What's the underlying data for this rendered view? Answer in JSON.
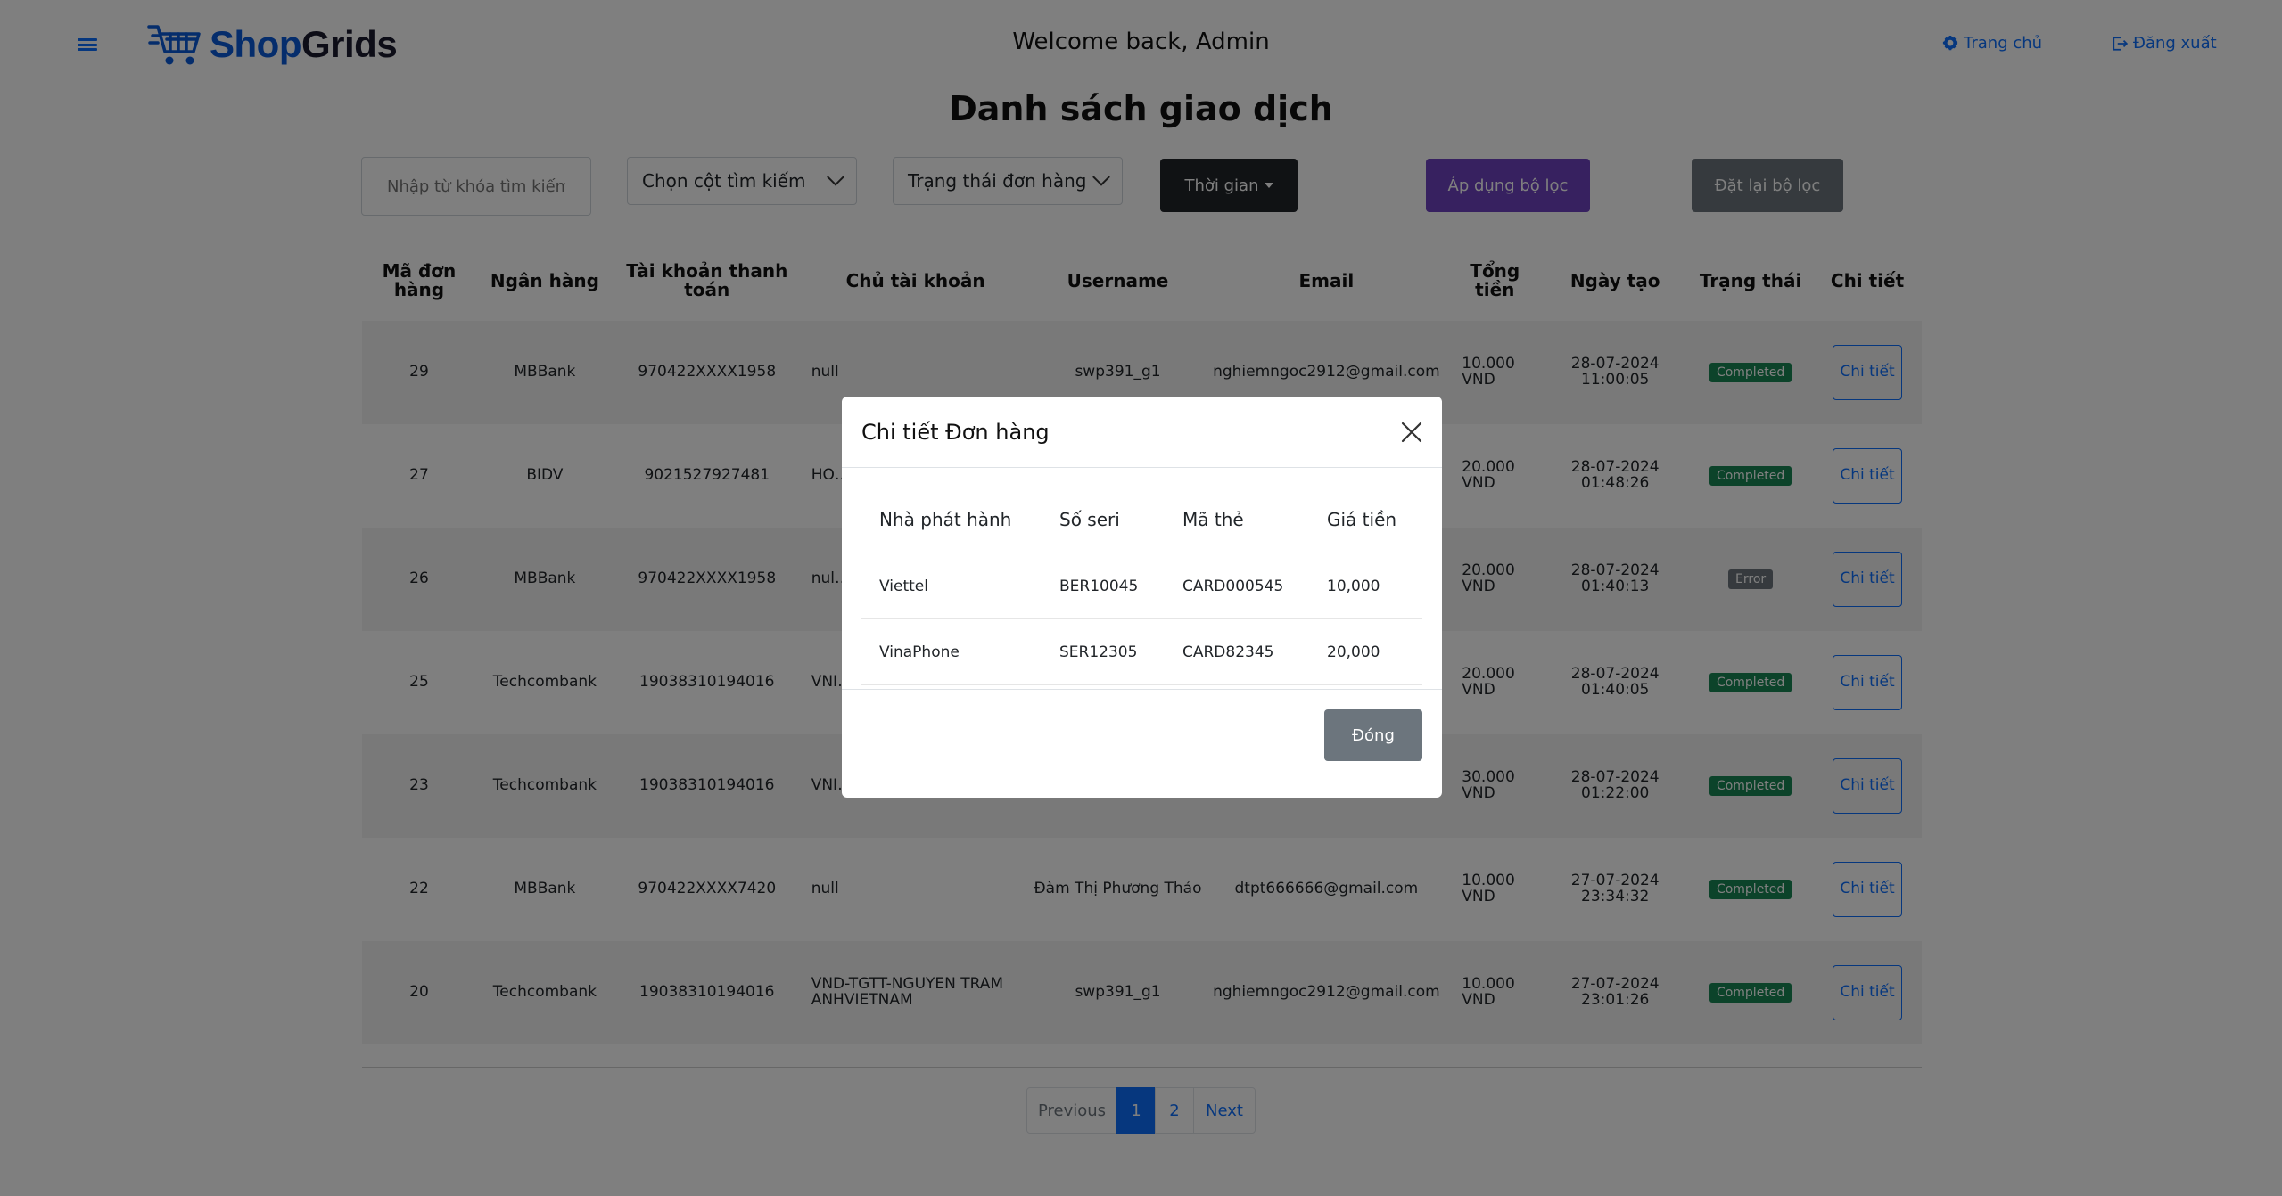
{
  "header": {
    "logo_shop": "Shop",
    "logo_grids": "Grids",
    "welcome": "Welcome back, Admin",
    "nav_home": "Trang chủ",
    "nav_logout": "Đăng xuất",
    "brand_color": "#0a5bd8"
  },
  "page": {
    "title": "Danh sách giao dịch"
  },
  "filters": {
    "search_placeholder": "Nhập từ khóa tìm kiếm",
    "column_select": "Chọn cột tìm kiếm",
    "status_select": "Trạng thái đơn hàng",
    "time_button": "Thời gian",
    "apply_button": "Áp dụng bộ lọc",
    "reset_button": "Đặt lại bộ lọc"
  },
  "table": {
    "headers": [
      "Mã đơn hàng",
      "Ngân hàng",
      "Tài khoản thanh toán",
      "Chủ tài khoản",
      "Username",
      "Email",
      "Tổng tiền",
      "Ngày tạo",
      "Trạng thái",
      "Chi tiết"
    ],
    "rows": [
      {
        "id": "29",
        "bank": "MBBank",
        "account": "970422XXXX1958",
        "owner": "null",
        "username": "swp391_g1",
        "email": "nghiemngoc2912@gmail.com",
        "total": "10.000 VND",
        "date": "28-07-2024 11:00:05",
        "status": "Completed",
        "detail": "Chi tiết"
      },
      {
        "id": "27",
        "bank": "BIDV",
        "account": "9021527927481",
        "owner": "HO… VIE…",
        "username": "",
        "email": "",
        "total": "20.000 VND",
        "date": "28-07-2024 01:48:26",
        "status": "Completed",
        "detail": "Chi tiết"
      },
      {
        "id": "26",
        "bank": "MBBank",
        "account": "970422XXXX1958",
        "owner": "nul…",
        "username": "",
        "email": "",
        "total": "20.000 VND",
        "date": "28-07-2024 01:40:13",
        "status": "Error",
        "detail": "Chi tiết"
      },
      {
        "id": "25",
        "bank": "Techcombank",
        "account": "19038310194016",
        "owner": "VNI… ANI…",
        "username": "",
        "email": "",
        "total": "20.000 VND",
        "date": "28-07-2024 01:40:05",
        "status": "Completed",
        "detail": "Chi tiết"
      },
      {
        "id": "23",
        "bank": "Techcombank",
        "account": "19038310194016",
        "owner": "VNI… ANHVIETNAM",
        "username": "",
        "email": "",
        "total": "30.000 VND",
        "date": "28-07-2024 01:22:00",
        "status": "Completed",
        "detail": "Chi tiết"
      },
      {
        "id": "22",
        "bank": "MBBank",
        "account": "970422XXXX7420",
        "owner": "null",
        "username": "Đàm Thị Phương Thảo",
        "email": "dtpt666666@gmail.com",
        "total": "10.000 VND",
        "date": "27-07-2024 23:34:32",
        "status": "Completed",
        "detail": "Chi tiết"
      },
      {
        "id": "20",
        "bank": "Techcombank",
        "account": "19038310194016",
        "owner": "VND-TGTT-NGUYEN TRAM ANHVIETNAM",
        "username": "swp391_g1",
        "email": "nghiemngoc2912@gmail.com",
        "total": "10.000 VND",
        "date": "27-07-2024 23:01:26",
        "status": "Completed",
        "detail": "Chi tiết"
      }
    ]
  },
  "pagination": {
    "prev": "Previous",
    "pages": [
      "1",
      "2"
    ],
    "current": "1",
    "next": "Next"
  },
  "modal": {
    "title": "Chi tiết Đơn hàng",
    "headers": [
      "Nhà phát hành",
      "Số seri",
      "Mã thẻ",
      "Giá tiền"
    ],
    "rows": [
      {
        "publisher": "Viettel",
        "serial": "BER10045",
        "code": "CARD000545",
        "price": "10,000"
      },
      {
        "publisher": "VinaPhone",
        "serial": "SER12305",
        "code": "CARD82345",
        "price": "20,000"
      }
    ],
    "close_button": "Đóng"
  }
}
